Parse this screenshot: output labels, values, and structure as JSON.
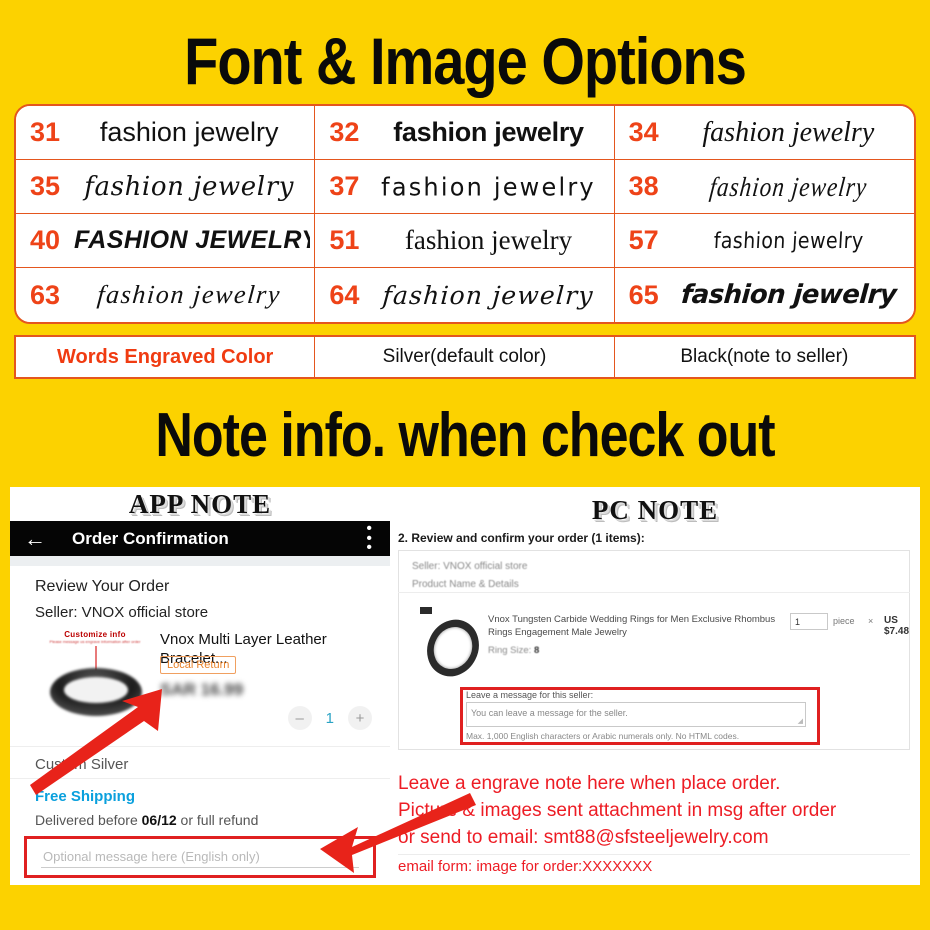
{
  "headings": {
    "fonts": "Font & Image Options",
    "note": "Note info. when check out"
  },
  "colors": {
    "background_yellow": "#FCD200",
    "table_border_orange": "#E4561E",
    "number_orange": "#EE4318",
    "highlight_red": "#E02020",
    "note_red": "#ED1C24",
    "link_blue": "#0AA0DD"
  },
  "font_table": {
    "sample_text": "fashion jewelry",
    "cells": [
      {
        "number": "31",
        "sample": "fashion jewelry"
      },
      {
        "number": "32",
        "sample": "fashion jewelry"
      },
      {
        "number": "34",
        "sample": "fashion jewelry"
      },
      {
        "number": "35",
        "sample": "fashion jewelry"
      },
      {
        "number": "37",
        "sample": "fashion jewelry"
      },
      {
        "number": "38",
        "sample": "fashion jewelry"
      },
      {
        "number": "40",
        "sample": "FASHION JEWELRY"
      },
      {
        "number": "51",
        "sample": "fashion jewelry"
      },
      {
        "number": "57",
        "sample": "fashion jewelry"
      },
      {
        "number": "63",
        "sample": "fashion jewelry"
      },
      {
        "number": "64",
        "sample": "fashion jewelry"
      },
      {
        "number": "65",
        "sample": "fashion jewelry"
      }
    ]
  },
  "color_row": {
    "label": "Words Engraved Color",
    "option_silver": "Silver(default color)",
    "option_black": "Black(note to seller)"
  },
  "app_note": {
    "title": "APP NOTE",
    "appbar_title": "Order Confirmation",
    "review_heading": "Review Your Order",
    "seller": "Seller: VNOX official store",
    "customize_title": "Customize info",
    "customize_sub": "Please message us engrave information after order",
    "product_name": "Vnox Multi Layer Leather Bracelet...",
    "badge": "Local Return",
    "price": "SAR 16.99",
    "qty_minus": "–",
    "qty_value": "1",
    "qty_plus": "+",
    "custom_silver": "Custom Silver",
    "free_shipping": "Free Shipping",
    "delivered_prefix": "Delivered before ",
    "delivered_date": "06/12",
    "delivered_suffix": " or full refund",
    "message_placeholder": "Optional message here (English only)"
  },
  "pc_note": {
    "title": "PC NOTE",
    "step_heading": "2. Review and confirm your order (1 items):",
    "seller": "Seller: VNOX official store",
    "product_name_details_label": "Product Name & Details",
    "product_name": "Vnox Tungsten Carbide Wedding Rings for Men Exclusive Rhombus Rings Engagement Male Jewelry",
    "ring_size_label": "Ring Size:",
    "ring_size_value": "8",
    "qty_value": "1",
    "unit": "piece",
    "times": "×",
    "price": "US $7.48",
    "message_label": "Leave a message for this seller:",
    "textarea_placeholder": "You can leave a message for the seller.",
    "hint": "Max. 1,000 English characters or Arabic numerals only. No HTML codes.",
    "note_line1": "Leave a engrave note here when place order.",
    "note_line2": "Picture & images sent attachment in msg after order",
    "note_line3": "or send to email: smt88@sfsteeljewelry.com",
    "note_line4": "email form: image for order:XXXXXXX"
  }
}
